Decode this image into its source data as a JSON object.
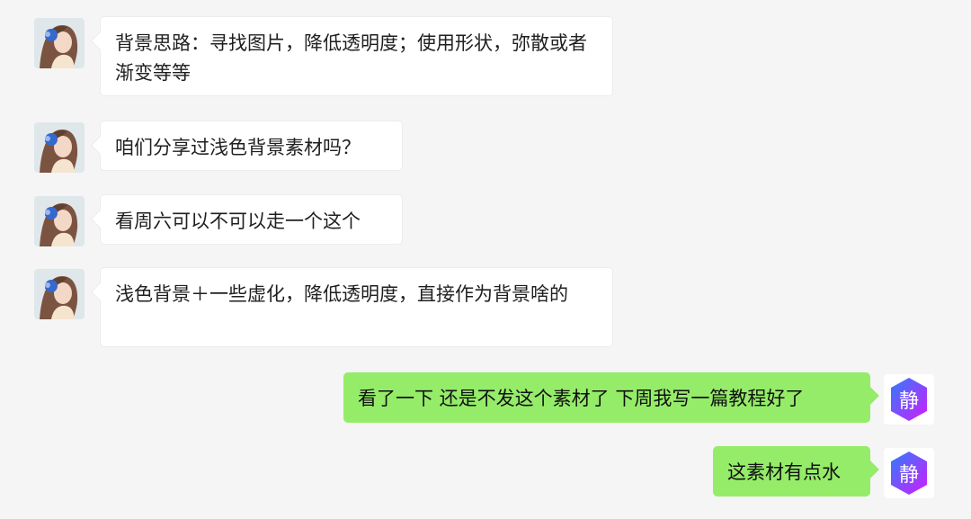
{
  "messages": [
    {
      "side": "left",
      "text": "背景思路：寻找图片，降低透明度；使用形状，弥散或者渐变等等"
    },
    {
      "side": "left",
      "text": "咱们分享过浅色背景素材吗？"
    },
    {
      "side": "left",
      "text": "看周六可以不可以走一个这个"
    },
    {
      "side": "left",
      "text": "浅色背景＋一些虚化，降低透明度，直接作为背景啥的"
    },
    {
      "side": "right",
      "text": "看了一下 还是不发这个素材了 下周我写一篇教程好了"
    },
    {
      "side": "right",
      "text": "这素材有点水"
    }
  ],
  "self_avatar": {
    "glyph": "静",
    "colors": [
      "#2e7dfc",
      "#d11cff"
    ]
  },
  "colors": {
    "background": "#f5f5f5",
    "incoming_bubble": "#ffffff",
    "outgoing_bubble": "#95ec69"
  },
  "icons": {
    "contact_avatar": "girl-portrait-avatar",
    "self_avatar": "hexagon-logo-avatar"
  }
}
